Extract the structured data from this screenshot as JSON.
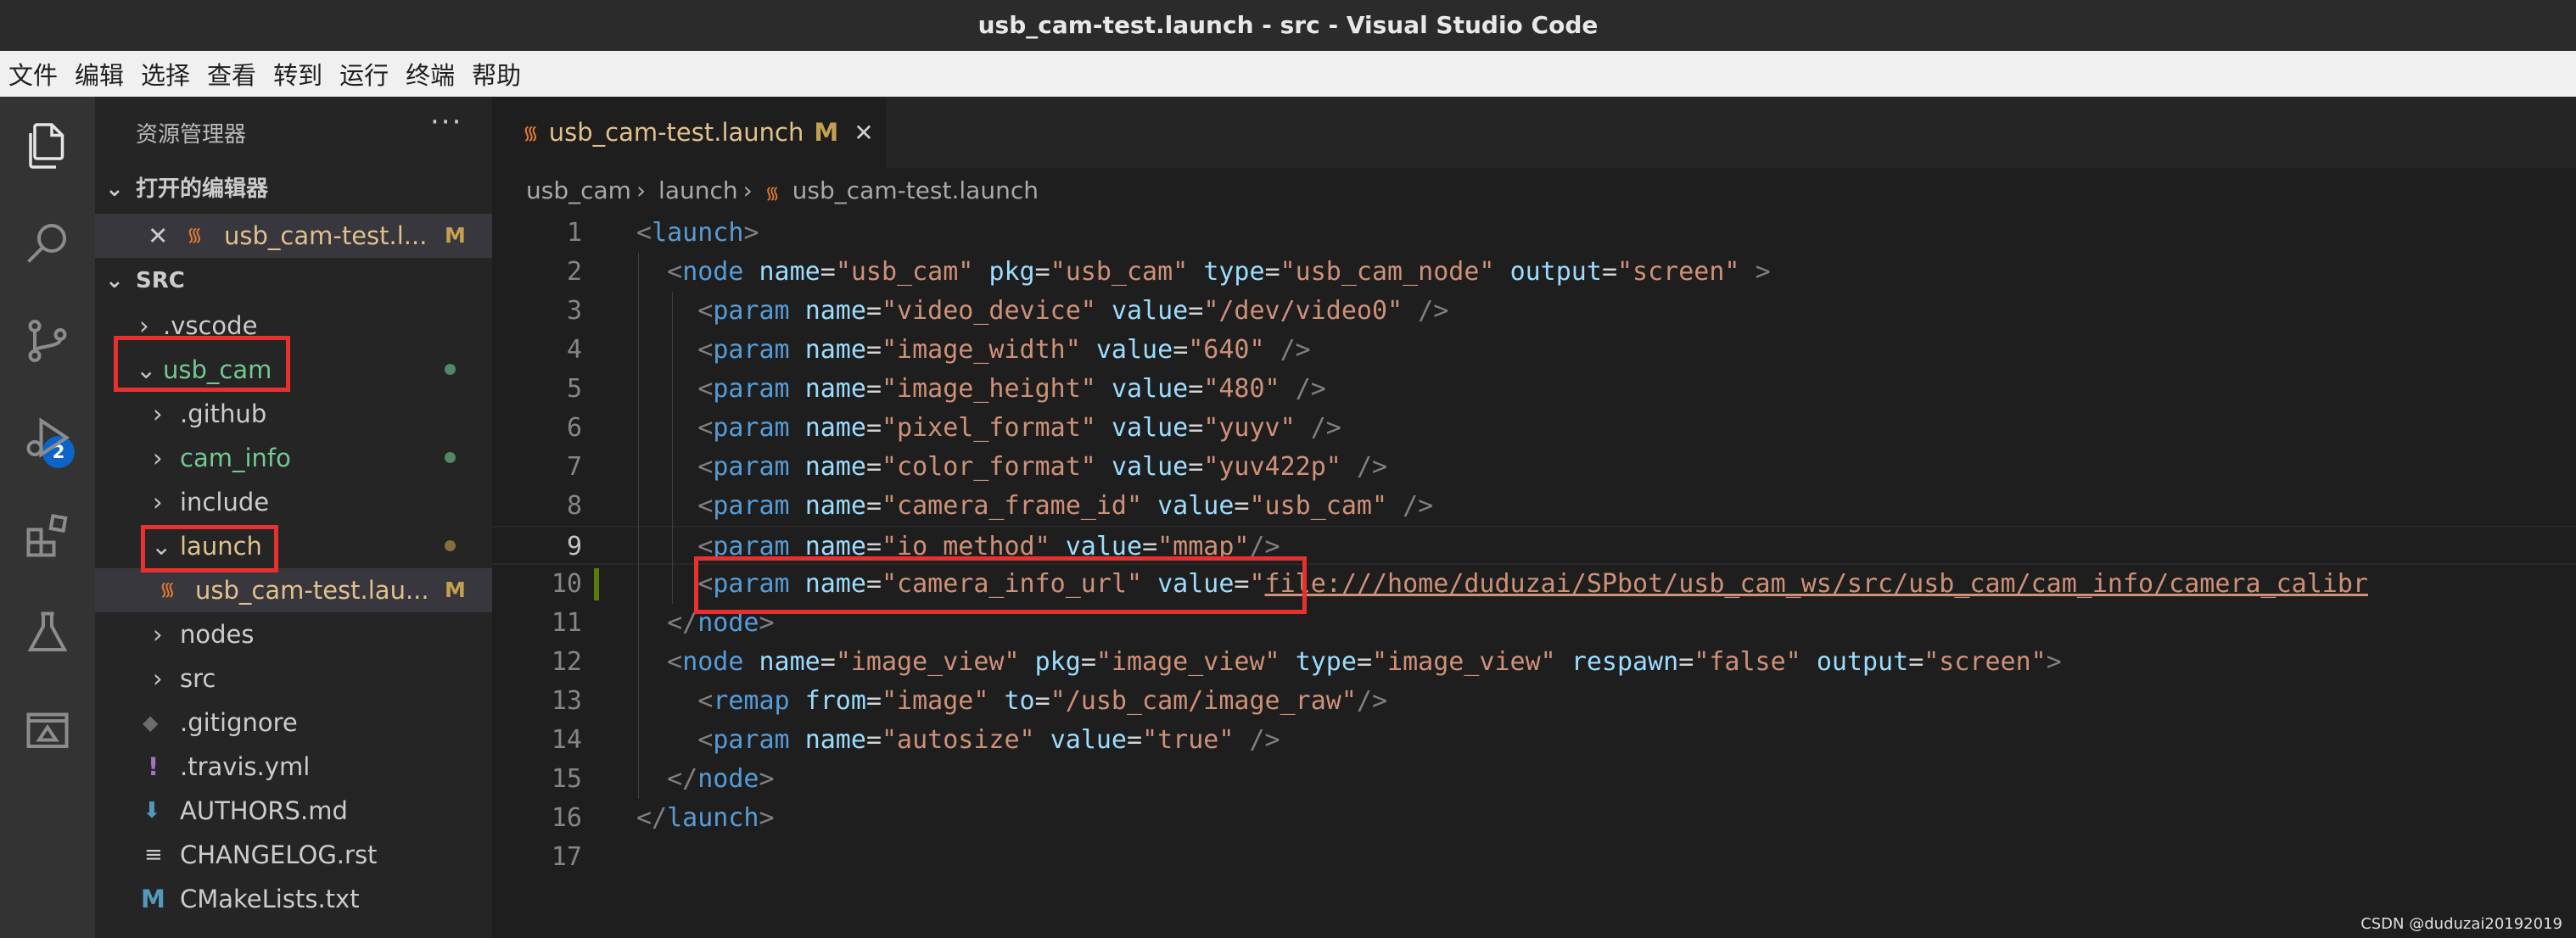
{
  "window": {
    "title": "usb_cam-test.launch - src - Visual Studio Code"
  },
  "menu": [
    "文件",
    "编辑",
    "选择",
    "查看",
    "转到",
    "运行",
    "终端",
    "帮助"
  ],
  "activity": {
    "source_control_badge": "2"
  },
  "sidebar": {
    "title": "资源管理器",
    "more": "···",
    "open_editors": {
      "header": "打开的编辑器",
      "files": [
        {
          "name": "usb_cam-test.l...",
          "status": "M"
        }
      ]
    },
    "workspace": {
      "header": "SRC",
      "items": [
        {
          "name": ".vscode",
          "kind": "folder",
          "expanded": false,
          "depth": 0,
          "status": ""
        },
        {
          "name": "usb_cam",
          "kind": "folder",
          "expanded": true,
          "depth": 0,
          "status": "dot"
        },
        {
          "name": ".github",
          "kind": "folder",
          "expanded": false,
          "depth": 1,
          "status": ""
        },
        {
          "name": "cam_info",
          "kind": "folder",
          "expanded": false,
          "depth": 1,
          "status": "dot"
        },
        {
          "name": "include",
          "kind": "folder",
          "expanded": false,
          "depth": 1,
          "status": ""
        },
        {
          "name": "launch",
          "kind": "folder",
          "expanded": true,
          "depth": 1,
          "status": "dot"
        },
        {
          "name": "usb_cam-test.lau...",
          "kind": "launch",
          "depth": 2,
          "status": "M"
        },
        {
          "name": "nodes",
          "kind": "folder",
          "expanded": false,
          "depth": 1,
          "status": ""
        },
        {
          "name": "src",
          "kind": "folder",
          "expanded": false,
          "depth": 1,
          "status": ""
        },
        {
          "name": ".gitignore",
          "kind": "git",
          "depth": 1,
          "status": ""
        },
        {
          "name": ".travis.yml",
          "kind": "yml",
          "depth": 1,
          "status": ""
        },
        {
          "name": "AUTHORS.md",
          "kind": "md",
          "depth": 1,
          "status": ""
        },
        {
          "name": "CHANGELOG.rst",
          "kind": "rst",
          "depth": 1,
          "status": ""
        },
        {
          "name": "CMakeLists.txt",
          "kind": "cmake",
          "depth": 1,
          "status": ""
        }
      ]
    }
  },
  "tab": {
    "name": "usb_cam-test.launch",
    "status": "M"
  },
  "breadcrumb": [
    "usb_cam",
    "launch",
    "usb_cam-test.launch"
  ],
  "editor": {
    "current_line": 9,
    "lines": [
      {
        "n": "1",
        "tokens": [
          [
            "pun",
            "<"
          ],
          [
            "tg",
            "launch"
          ],
          [
            "pun",
            ">"
          ]
        ]
      },
      {
        "n": "2",
        "tokens": [
          [
            "txt",
            "  "
          ],
          [
            "pun",
            "<"
          ],
          [
            "tg",
            "node"
          ],
          [
            "txt",
            " "
          ],
          [
            "at",
            "name"
          ],
          [
            "eq",
            "="
          ],
          [
            "st",
            "\"usb_cam\""
          ],
          [
            "txt",
            " "
          ],
          [
            "at",
            "pkg"
          ],
          [
            "eq",
            "="
          ],
          [
            "st",
            "\"usb_cam\""
          ],
          [
            "txt",
            " "
          ],
          [
            "at",
            "type"
          ],
          [
            "eq",
            "="
          ],
          [
            "st",
            "\"usb_cam_node\""
          ],
          [
            "txt",
            " "
          ],
          [
            "at",
            "output"
          ],
          [
            "eq",
            "="
          ],
          [
            "st",
            "\"screen\""
          ],
          [
            "txt",
            " "
          ],
          [
            "pun",
            ">"
          ]
        ]
      },
      {
        "n": "3",
        "tokens": [
          [
            "txt",
            "    "
          ],
          [
            "pun",
            "<"
          ],
          [
            "tg",
            "param"
          ],
          [
            "txt",
            " "
          ],
          [
            "at",
            "name"
          ],
          [
            "eq",
            "="
          ],
          [
            "st",
            "\"video_device\""
          ],
          [
            "txt",
            " "
          ],
          [
            "at",
            "value"
          ],
          [
            "eq",
            "="
          ],
          [
            "st",
            "\"/dev/video0\""
          ],
          [
            "txt",
            " "
          ],
          [
            "pun",
            "/>"
          ]
        ]
      },
      {
        "n": "4",
        "tokens": [
          [
            "txt",
            "    "
          ],
          [
            "pun",
            "<"
          ],
          [
            "tg",
            "param"
          ],
          [
            "txt",
            " "
          ],
          [
            "at",
            "name"
          ],
          [
            "eq",
            "="
          ],
          [
            "st",
            "\"image_width\""
          ],
          [
            "txt",
            " "
          ],
          [
            "at",
            "value"
          ],
          [
            "eq",
            "="
          ],
          [
            "st",
            "\"640\""
          ],
          [
            "txt",
            " "
          ],
          [
            "pun",
            "/>"
          ]
        ]
      },
      {
        "n": "5",
        "tokens": [
          [
            "txt",
            "    "
          ],
          [
            "pun",
            "<"
          ],
          [
            "tg",
            "param"
          ],
          [
            "txt",
            " "
          ],
          [
            "at",
            "name"
          ],
          [
            "eq",
            "="
          ],
          [
            "st",
            "\"image_height\""
          ],
          [
            "txt",
            " "
          ],
          [
            "at",
            "value"
          ],
          [
            "eq",
            "="
          ],
          [
            "st",
            "\"480\""
          ],
          [
            "txt",
            " "
          ],
          [
            "pun",
            "/>"
          ]
        ]
      },
      {
        "n": "6",
        "tokens": [
          [
            "txt",
            "    "
          ],
          [
            "pun",
            "<"
          ],
          [
            "tg",
            "param"
          ],
          [
            "txt",
            " "
          ],
          [
            "at",
            "name"
          ],
          [
            "eq",
            "="
          ],
          [
            "st",
            "\"pixel_format\""
          ],
          [
            "txt",
            " "
          ],
          [
            "at",
            "value"
          ],
          [
            "eq",
            "="
          ],
          [
            "st",
            "\"yuyv\""
          ],
          [
            "txt",
            " "
          ],
          [
            "pun",
            "/>"
          ]
        ]
      },
      {
        "n": "7",
        "tokens": [
          [
            "txt",
            "    "
          ],
          [
            "pun",
            "<"
          ],
          [
            "tg",
            "param"
          ],
          [
            "txt",
            " "
          ],
          [
            "at",
            "name"
          ],
          [
            "eq",
            "="
          ],
          [
            "st",
            "\"color_format\""
          ],
          [
            "txt",
            " "
          ],
          [
            "at",
            "value"
          ],
          [
            "eq",
            "="
          ],
          [
            "st",
            "\"yuv422p\""
          ],
          [
            "txt",
            " "
          ],
          [
            "pun",
            "/>"
          ]
        ]
      },
      {
        "n": "8",
        "tokens": [
          [
            "txt",
            "    "
          ],
          [
            "pun",
            "<"
          ],
          [
            "tg",
            "param"
          ],
          [
            "txt",
            " "
          ],
          [
            "at",
            "name"
          ],
          [
            "eq",
            "="
          ],
          [
            "st",
            "\"camera_frame_id\""
          ],
          [
            "txt",
            " "
          ],
          [
            "at",
            "value"
          ],
          [
            "eq",
            "="
          ],
          [
            "st",
            "\"usb_cam\""
          ],
          [
            "txt",
            " "
          ],
          [
            "pun",
            "/>"
          ]
        ]
      },
      {
        "n": "9",
        "tokens": [
          [
            "txt",
            "    "
          ],
          [
            "pun",
            "<"
          ],
          [
            "tg",
            "param"
          ],
          [
            "txt",
            " "
          ],
          [
            "at",
            "name"
          ],
          [
            "eq",
            "="
          ],
          [
            "st",
            "\"io_method\""
          ],
          [
            "txt",
            " "
          ],
          [
            "at",
            "value"
          ],
          [
            "eq",
            "="
          ],
          [
            "st",
            "\"mmap\""
          ],
          [
            "pun",
            "/>"
          ]
        ]
      },
      {
        "n": "10",
        "tokens": [
          [
            "txt",
            "    "
          ],
          [
            "pun",
            "<"
          ],
          [
            "tg",
            "param"
          ],
          [
            "txt",
            " "
          ],
          [
            "at",
            "name"
          ],
          [
            "eq",
            "="
          ],
          [
            "st",
            "\"camera_info_url\""
          ],
          [
            "txt",
            " "
          ],
          [
            "at",
            "value"
          ],
          [
            "eq",
            "="
          ],
          [
            "st",
            "\""
          ],
          [
            "lnk",
            "file:///home/duduzai/SPbot/usb_cam_ws/src/usb_cam/cam_info/camera_calibr"
          ]
        ]
      },
      {
        "n": "11",
        "tokens": [
          [
            "txt",
            "  "
          ],
          [
            "pun",
            "</"
          ],
          [
            "tg",
            "node"
          ],
          [
            "pun",
            ">"
          ]
        ]
      },
      {
        "n": "12",
        "tokens": [
          [
            "txt",
            "  "
          ],
          [
            "pun",
            "<"
          ],
          [
            "tg",
            "node"
          ],
          [
            "txt",
            " "
          ],
          [
            "at",
            "name"
          ],
          [
            "eq",
            "="
          ],
          [
            "st",
            "\"image_view\""
          ],
          [
            "txt",
            " "
          ],
          [
            "at",
            "pkg"
          ],
          [
            "eq",
            "="
          ],
          [
            "st",
            "\"image_view\""
          ],
          [
            "txt",
            " "
          ],
          [
            "at",
            "type"
          ],
          [
            "eq",
            "="
          ],
          [
            "st",
            "\"image_view\""
          ],
          [
            "txt",
            " "
          ],
          [
            "at",
            "respawn"
          ],
          [
            "eq",
            "="
          ],
          [
            "st",
            "\"false\""
          ],
          [
            "txt",
            " "
          ],
          [
            "at",
            "output"
          ],
          [
            "eq",
            "="
          ],
          [
            "st",
            "\"screen\""
          ],
          [
            "pun",
            ">"
          ]
        ]
      },
      {
        "n": "13",
        "tokens": [
          [
            "txt",
            "    "
          ],
          [
            "pun",
            "<"
          ],
          [
            "tg",
            "remap"
          ],
          [
            "txt",
            " "
          ],
          [
            "at",
            "from"
          ],
          [
            "eq",
            "="
          ],
          [
            "st",
            "\"image\""
          ],
          [
            "txt",
            " "
          ],
          [
            "at",
            "to"
          ],
          [
            "eq",
            "="
          ],
          [
            "st",
            "\"/usb_cam/image_raw\""
          ],
          [
            "pun",
            "/>"
          ]
        ]
      },
      {
        "n": "14",
        "tokens": [
          [
            "txt",
            "    "
          ],
          [
            "pun",
            "<"
          ],
          [
            "tg",
            "param"
          ],
          [
            "txt",
            " "
          ],
          [
            "at",
            "name"
          ],
          [
            "eq",
            "="
          ],
          [
            "st",
            "\"autosize\""
          ],
          [
            "txt",
            " "
          ],
          [
            "at",
            "value"
          ],
          [
            "eq",
            "="
          ],
          [
            "st",
            "\"true\""
          ],
          [
            "txt",
            " "
          ],
          [
            "pun",
            "/>"
          ]
        ]
      },
      {
        "n": "15",
        "tokens": [
          [
            "txt",
            "  "
          ],
          [
            "pun",
            "</"
          ],
          [
            "tg",
            "node"
          ],
          [
            "pun",
            ">"
          ]
        ]
      },
      {
        "n": "16",
        "tokens": [
          [
            "pun",
            "</"
          ],
          [
            "tg",
            "launch"
          ],
          [
            "pun",
            ">"
          ]
        ]
      },
      {
        "n": "17",
        "tokens": []
      }
    ]
  },
  "watermark": "CSDN @duduzai20192019",
  "colors": {
    "annotation_box": "#e8312f",
    "accent": "#0e63c7",
    "modified": "#c4a050"
  }
}
